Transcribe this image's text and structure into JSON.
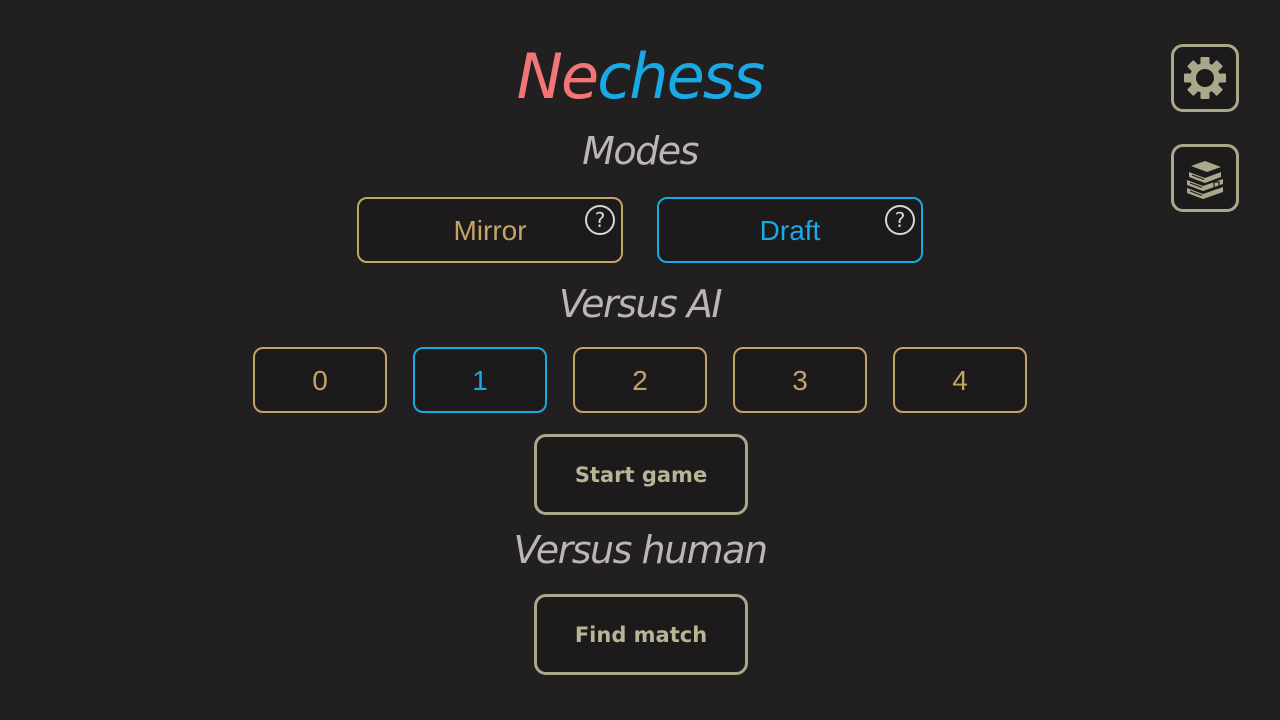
{
  "title": {
    "part1": "Ne",
    "part2": "chess"
  },
  "modes": {
    "heading": "Modes",
    "buttons": [
      {
        "label": "Mirror",
        "help": "?",
        "selected": false
      },
      {
        "label": "Draft",
        "help": "?",
        "selected": true
      }
    ]
  },
  "versus_ai": {
    "heading": "Versus AI",
    "levels": [
      "0",
      "1",
      "2",
      "3",
      "4"
    ],
    "selected_level": "1",
    "start_label": "Start game"
  },
  "versus_human": {
    "heading": "Versus human",
    "find_label": "Find match"
  },
  "side": {
    "settings_icon": "gear-icon",
    "rules_icon": "books-icon"
  },
  "colors": {
    "background": "#221f20",
    "accent_gold": "#c4a465",
    "accent_blue": "#19a9e5",
    "title_red": "#f27677",
    "heading_gray": "#b9b6b4",
    "action_olive": "#b8b596"
  }
}
